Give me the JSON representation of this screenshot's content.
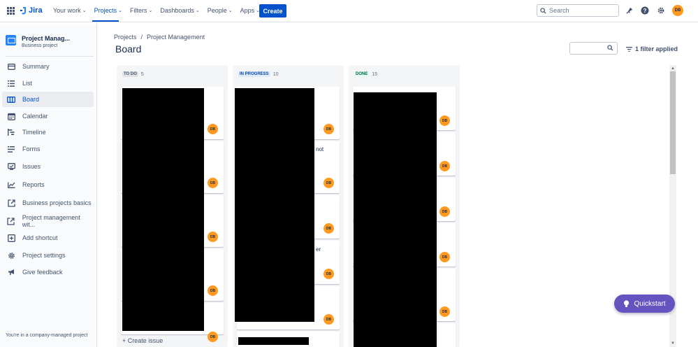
{
  "topnav": {
    "product": "Jira",
    "items": [
      {
        "label": "Your work"
      },
      {
        "label": "Projects"
      },
      {
        "label": "Filters"
      },
      {
        "label": "Dashboards"
      },
      {
        "label": "People"
      },
      {
        "label": "Apps"
      }
    ],
    "create_label": "Create",
    "search_placeholder": "Search",
    "avatar_initials": "DB",
    "accent": "#0052cc"
  },
  "sidebar": {
    "project_name": "Project Manag...",
    "project_type": "Business project",
    "items": [
      {
        "label": "Summary",
        "icon": "summary-icon"
      },
      {
        "label": "List",
        "icon": "list-icon"
      },
      {
        "label": "Board",
        "icon": "board-icon",
        "selected": true
      },
      {
        "label": "Calendar",
        "icon": "calendar-icon"
      },
      {
        "label": "Timeline",
        "icon": "timeline-icon"
      },
      {
        "label": "Forms",
        "icon": "forms-icon"
      },
      {
        "label": "Issues",
        "icon": "issues-icon"
      },
      {
        "label": "Reports",
        "icon": "reports-icon"
      },
      {
        "label": "Business projects basics",
        "icon": "external-link-icon"
      },
      {
        "label": "Project management wit...",
        "icon": "external-link-icon"
      },
      {
        "label": "Add shortcut",
        "icon": "add-icon"
      },
      {
        "label": "Project settings",
        "icon": "gear-icon"
      },
      {
        "label": "Give feedback",
        "icon": "megaphone-icon"
      }
    ],
    "footer": "You're in a company-managed project"
  },
  "breadcrumb": {
    "items": [
      "Projects",
      "Project Management"
    ],
    "separator": "/"
  },
  "page_title": "Board",
  "filter_label": "1 filter applied",
  "columns": [
    {
      "name": "TO DO",
      "count": "5",
      "badge_color": "#dfe1e6",
      "text_color": "#42526e",
      "create_label": "+ Create issue"
    },
    {
      "name": "IN PROGRESS",
      "count": "10",
      "badge_color": "#deebff",
      "text_color": "#0747a6"
    },
    {
      "name": "DONE",
      "count": "15",
      "badge_color": "#e3fcef",
      "text_color": "#006644"
    }
  ],
  "cards": {
    "avatar_initials": "DB",
    "inprogress_fragments": [
      "not",
      "er"
    ]
  },
  "quickstart_label": "Quickstart"
}
